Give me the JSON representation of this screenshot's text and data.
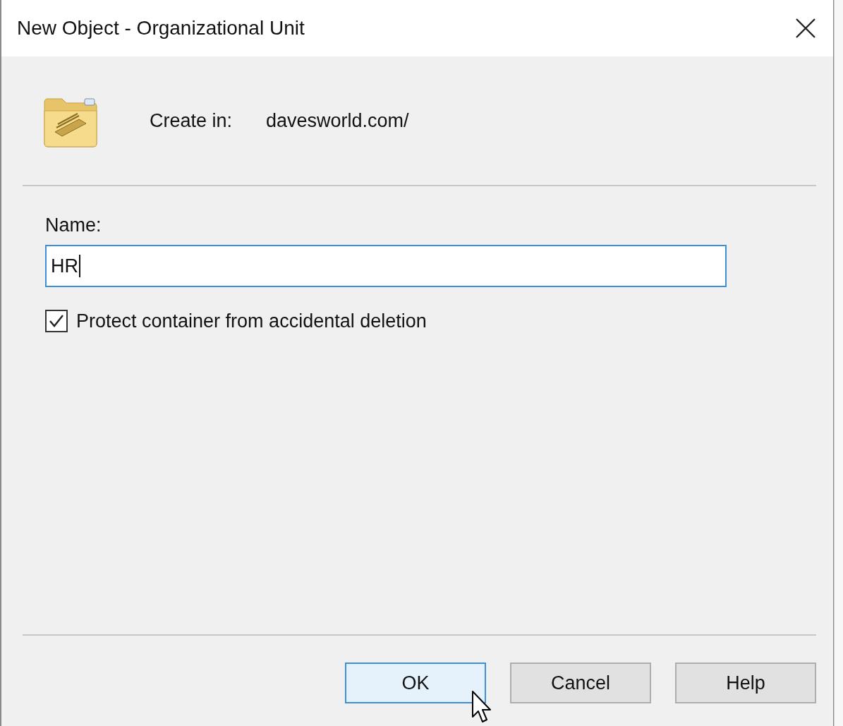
{
  "window": {
    "title": "New Object - Organizational Unit"
  },
  "create_in": {
    "label": "Create in:",
    "value": "davesworld.com/"
  },
  "name_field": {
    "label": "Name:",
    "value": "HR",
    "focused": true
  },
  "protect": {
    "label": "Protect container from accidental deletion",
    "checked": true
  },
  "buttons": [
    {
      "label": "OK",
      "default": true
    },
    {
      "label": "Cancel",
      "default": false
    },
    {
      "label": "Help",
      "default": false
    }
  ]
}
